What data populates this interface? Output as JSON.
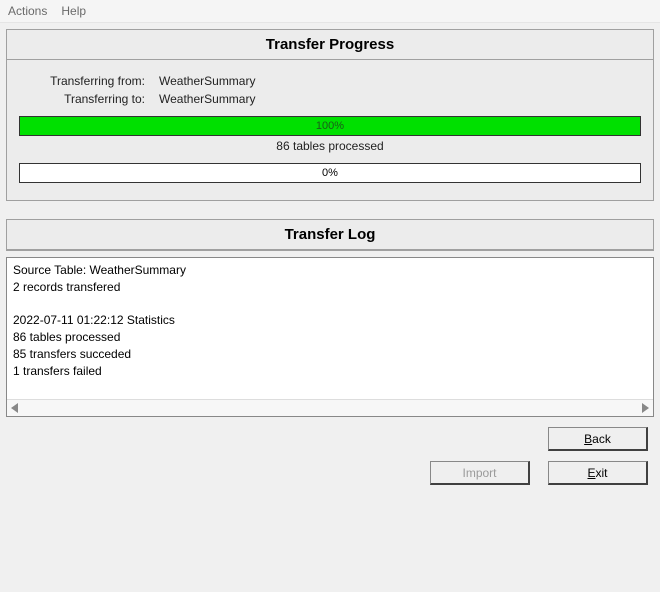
{
  "menubar": {
    "actions": "Actions",
    "help": "Help"
  },
  "progress": {
    "title": "Transfer Progress",
    "from_label": "Transferring from:",
    "from_value": "WeatherSummary",
    "to_label": "Transferring to:",
    "to_value": "WeatherSummary",
    "bar1_percent": "100%",
    "bar1_width": "100%",
    "bar1_sub": "86 tables processed",
    "bar2_percent": "0%",
    "bar2_width": "0%"
  },
  "log": {
    "title": "Transfer Log",
    "text": "Source Table: WeatherSummary\n2 records transfered\n\n2022-07-11 01:22:12 Statistics\n86 tables processed\n85 transfers succeded\n1 transfers failed"
  },
  "buttons": {
    "back_prefix": "B",
    "back_rest": "ack",
    "import": "Import",
    "exit_prefix": "E",
    "exit_rest": "xit"
  }
}
